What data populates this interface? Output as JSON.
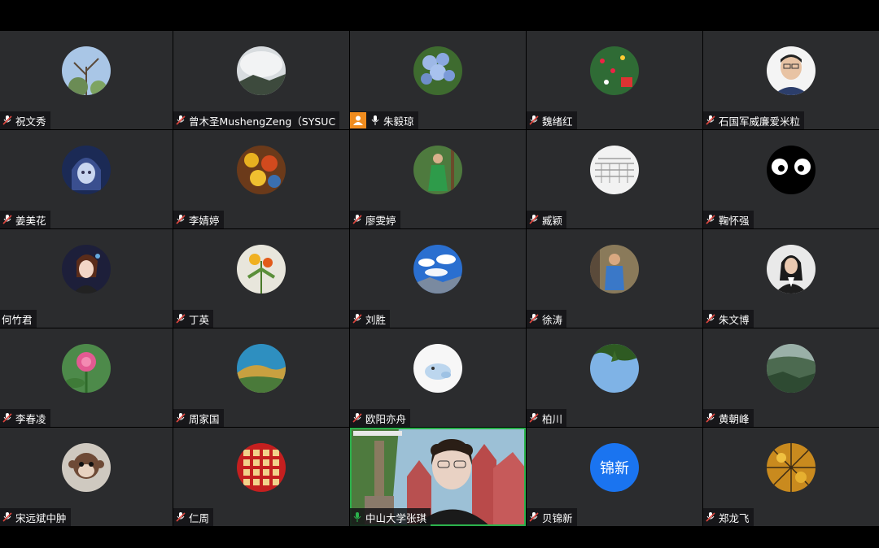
{
  "participants": [
    {
      "name": "祝文秀",
      "mic": "muted"
    },
    {
      "name": "曾木圣MushengZeng（SYSUC",
      "mic": "muted"
    },
    {
      "name": "朱毅琼",
      "mic": "on",
      "role": "host"
    },
    {
      "name": "魏绪红",
      "mic": "muted"
    },
    {
      "name": "石国军威廉爱米粒",
      "mic": "muted"
    },
    {
      "name": "姜美花",
      "mic": "muted"
    },
    {
      "name": "李婧婷",
      "mic": "muted"
    },
    {
      "name": "廖雯婷",
      "mic": "muted"
    },
    {
      "name": "臧颖",
      "mic": "muted"
    },
    {
      "name": "鞠怀强",
      "mic": "muted"
    },
    {
      "name": "何竹君",
      "mic": "none"
    },
    {
      "name": "丁英",
      "mic": "muted"
    },
    {
      "name": "刘胜",
      "mic": "muted"
    },
    {
      "name": "徐涛",
      "mic": "muted"
    },
    {
      "name": "朱文博",
      "mic": "muted"
    },
    {
      "name": "李春凌",
      "mic": "muted"
    },
    {
      "name": "周家国",
      "mic": "muted"
    },
    {
      "name": "欧阳亦舟",
      "mic": "muted"
    },
    {
      "name": "柏川",
      "mic": "muted"
    },
    {
      "name": "黄朝峰",
      "mic": "muted"
    },
    {
      "name": "宋远斌中肿",
      "mic": "muted"
    },
    {
      "name": "仁周",
      "mic": "muted"
    },
    {
      "name": "中山大学张琪",
      "mic": "speaking",
      "video": true
    },
    {
      "name": "贝锦新",
      "mic": "muted",
      "avatar_text": "锦新"
    },
    {
      "name": "郑龙飞",
      "mic": "muted"
    }
  ],
  "colors": {
    "tile": "#2b2c2e",
    "speaking": "#2bb24c",
    "muted": "#e0463f",
    "avatar_blue": "#1a74f0",
    "host": "#f08c1e"
  }
}
